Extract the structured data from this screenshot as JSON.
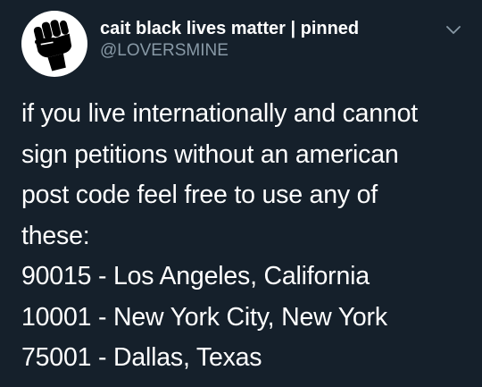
{
  "tweet": {
    "author": {
      "display_name": "cait black lives matter | pinned",
      "handle": "@LOVERSMINE",
      "avatar_icon": "raised-fist-icon"
    },
    "menu_icon": "chevron-down-icon",
    "body_lines": [
      "if you live internationally and cannot",
      "sign petitions without an american",
      "post code feel free to use any of",
      "these:",
      "90015 - Los Angeles, California",
      "10001 - New York City, New York",
      "75001 - Dallas, Texas"
    ]
  },
  "colors": {
    "background": "#15202b",
    "text_primary": "#ffffff",
    "text_secondary": "#8899a6"
  }
}
